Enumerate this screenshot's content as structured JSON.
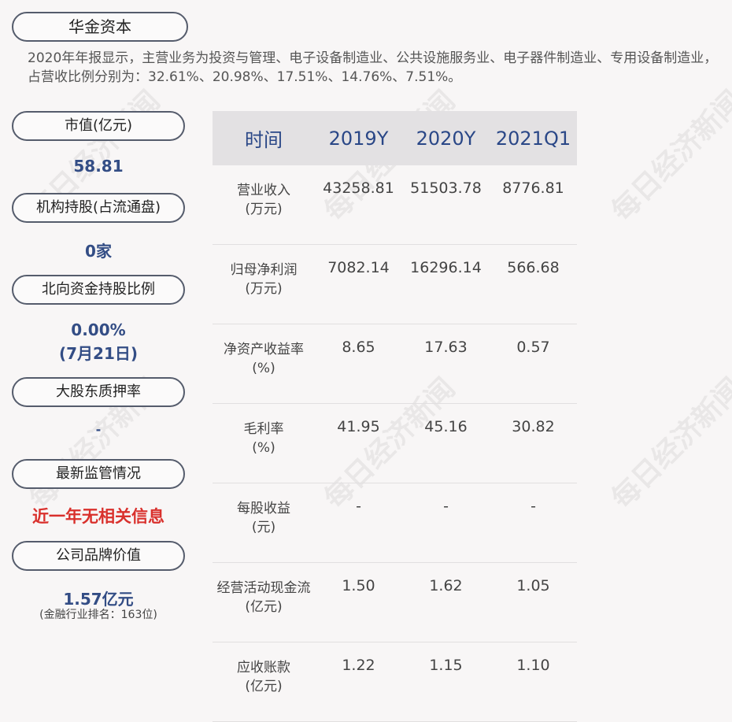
{
  "company": "华金资本",
  "intro": "2020年年报显示，主营业务为投资与管理、电子设备制造业、公共设施服务业、电子器件制造业、专用设备制造业，占营收比例分别为：32.61%、20.98%、17.51%、14.76%、7.51%。",
  "left": {
    "market_cap": {
      "label": "市值(亿元)",
      "value": "58.81"
    },
    "institution": {
      "label": "机构持股(占流通盘)",
      "value": "0家"
    },
    "northbound": {
      "label": "北向资金持股比例",
      "value": "0.00%",
      "sub": "(7月21日)"
    },
    "pledge": {
      "label": "大股东质押率",
      "value": "-"
    },
    "regulation": {
      "label": "最新监管情况",
      "value": "近一年无相关信息"
    },
    "brand": {
      "label": "公司品牌价值",
      "value": "1.57亿元",
      "sub": "(金融行业排名：163位)"
    }
  },
  "table": {
    "headers": [
      "时间",
      "2019Y",
      "2020Y",
      "2021Q1"
    ],
    "rows": [
      {
        "label1": "营业收入",
        "label2": "(万元)",
        "values": [
          "43258.81",
          "51503.78",
          "8776.81"
        ]
      },
      {
        "label1": "归母净利润",
        "label2": "(万元)",
        "values": [
          "7082.14",
          "16296.14",
          "566.68"
        ]
      },
      {
        "label1": "净资产收益率",
        "label2": "(%)",
        "values": [
          "8.65",
          "17.63",
          "0.57"
        ]
      },
      {
        "label1": "毛利率",
        "label2": "(%)",
        "values": [
          "41.95",
          "45.16",
          "30.82"
        ]
      },
      {
        "label1": "每股收益",
        "label2": "(元)",
        "values": [
          "-",
          "-",
          "-"
        ]
      },
      {
        "label1": "经营活动现金流",
        "label2": "(亿元)",
        "values": [
          "1.50",
          "1.62",
          "1.05"
        ]
      },
      {
        "label1": "应收账款",
        "label2": "(亿元)",
        "values": [
          "1.22",
          "1.15",
          "1.10"
        ]
      }
    ]
  },
  "watermark": "每日经济新闻"
}
